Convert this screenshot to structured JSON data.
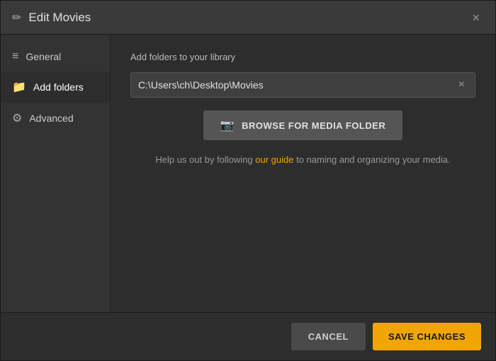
{
  "dialog": {
    "title": "Edit Movies",
    "close_label": "×"
  },
  "sidebar": {
    "items": [
      {
        "id": "general",
        "label": "General",
        "icon": "≡",
        "icon_class": "icon-general"
      },
      {
        "id": "add-folders",
        "label": "Add folders",
        "icon": "📁",
        "icon_class": "icon-folders",
        "active": true
      },
      {
        "id": "advanced",
        "label": "Advanced",
        "icon": "⚙",
        "icon_class": "icon-advanced"
      }
    ]
  },
  "main": {
    "section_label": "Add folders to your library",
    "folder_path": "C:\\Users\\ch\\Desktop\\Movies",
    "folder_clear_label": "×",
    "browse_button_label": "BROWSE FOR MEDIA FOLDER",
    "help_text_before": "Help us out by following ",
    "help_link_label": "our guide",
    "help_text_after": " to naming and organizing your media."
  },
  "footer": {
    "cancel_label": "CANCEL",
    "save_label": "SAVE CHANGES"
  }
}
